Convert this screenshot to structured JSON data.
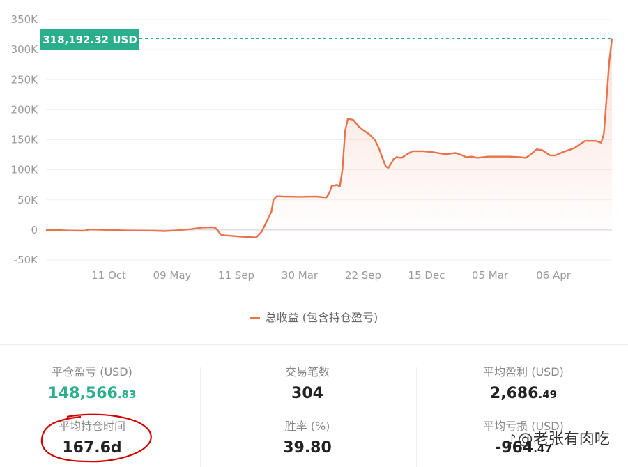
{
  "chart_data": {
    "type": "area",
    "y_ticks": [
      "350K",
      "300K",
      "250K",
      "200K",
      "150K",
      "100K",
      "50K",
      "0",
      "-50K"
    ],
    "y_tick_values": [
      350000,
      300000,
      250000,
      200000,
      150000,
      100000,
      50000,
      0,
      -50000
    ],
    "x_ticks": [
      "11 Oct",
      "09 May",
      "11 Sep",
      "30 Mar",
      "22 Sep",
      "15 Dec",
      "05 Mar",
      "06 Apr"
    ],
    "ylim": [
      -50000,
      350000
    ],
    "current_label": "318,192.32 USD",
    "current_value": 318192.32,
    "series": [
      {
        "name": "总收益 (包含持仓盈亏)",
        "color": "#E8734A",
        "points": [
          [
            0,
            0
          ],
          [
            0.02,
            -200
          ],
          [
            0.04,
            -1000
          ],
          [
            0.07,
            -1400
          ],
          [
            0.075,
            -500
          ],
          [
            0.08,
            800
          ],
          [
            0.1,
            300
          ],
          [
            0.15,
            -800
          ],
          [
            0.2,
            -1200
          ],
          [
            0.22,
            -2000
          ],
          [
            0.24,
            -800
          ],
          [
            0.27,
            1500
          ],
          [
            0.29,
            4000
          ],
          [
            0.31,
            4500
          ],
          [
            0.315,
            3000
          ],
          [
            0.325,
            -8000
          ],
          [
            0.33,
            -9000
          ],
          [
            0.34,
            -9500
          ],
          [
            0.36,
            -11000
          ],
          [
            0.38,
            -12000
          ],
          [
            0.39,
            -12500
          ],
          [
            0.4,
            -3000
          ],
          [
            0.41,
            15000
          ],
          [
            0.418,
            30000
          ],
          [
            0.422,
            50000
          ],
          [
            0.428,
            56000
          ],
          [
            0.44,
            55500
          ],
          [
            0.47,
            55000
          ],
          [
            0.5,
            55500
          ],
          [
            0.52,
            54000
          ],
          [
            0.525,
            60000
          ],
          [
            0.53,
            73000
          ],
          [
            0.54,
            75000
          ],
          [
            0.545,
            72000
          ],
          [
            0.55,
            100000
          ],
          [
            0.555,
            165000
          ],
          [
            0.56,
            185000
          ],
          [
            0.57,
            183000
          ],
          [
            0.58,
            172000
          ],
          [
            0.59,
            165000
          ],
          [
            0.6,
            159000
          ],
          [
            0.61,
            150000
          ],
          [
            0.618,
            135000
          ],
          [
            0.625,
            118000
          ],
          [
            0.63,
            106000
          ],
          [
            0.635,
            103000
          ],
          [
            0.64,
            110000
          ],
          [
            0.645,
            118000
          ],
          [
            0.65,
            121000
          ],
          [
            0.66,
            120000
          ],
          [
            0.67,
            126000
          ],
          [
            0.68,
            131000
          ],
          [
            0.7,
            131000
          ],
          [
            0.72,
            129000
          ],
          [
            0.74,
            126000
          ],
          [
            0.76,
            128000
          ],
          [
            0.77,
            125000
          ],
          [
            0.78,
            121000
          ],
          [
            0.79,
            122000
          ],
          [
            0.8,
            120000
          ],
          [
            0.82,
            122000
          ],
          [
            0.86,
            122000
          ],
          [
            0.88,
            121000
          ],
          [
            0.89,
            120000
          ],
          [
            0.9,
            126000
          ],
          [
            0.91,
            134000
          ],
          [
            0.92,
            133000
          ],
          [
            0.935,
            124000
          ],
          [
            0.945,
            124000
          ],
          [
            0.96,
            130000
          ],
          [
            0.98,
            136000
          ],
          [
            0.99,
            142000
          ],
          [
            1.0,
            148000
          ],
          [
            1.02,
            148000
          ],
          [
            1.03,
            145000
          ],
          [
            1.035,
            160000
          ],
          [
            1.04,
            220000
          ],
          [
            1.045,
            280000
          ],
          [
            1.05,
            318000
          ]
        ]
      }
    ]
  },
  "legend": {
    "label": "总收益 (包含持仓盈亏)"
  },
  "stats": {
    "closed_pnl": {
      "label": "平仓盈亏 (USD)",
      "int": "148,566",
      "dec": ".83"
    },
    "hold_time": {
      "label": "平均持仓时间",
      "value": "167.6d"
    },
    "trades": {
      "label": "交易笔数",
      "value": "304"
    },
    "win_rate": {
      "label": "胜率 (%)",
      "value": "39.80"
    },
    "avg_profit": {
      "label": "平均盈利 (USD)",
      "int": "2,686",
      "dec": ".49"
    },
    "avg_loss": {
      "label": "平均亏损 (USD)",
      "int": "-964",
      "dec": ".47"
    }
  },
  "watermark": {
    "text": "@老张有肉吃"
  },
  "colors": {
    "line": "#E8734A",
    "accent_green": "#2BAE8C",
    "annotation": "#d40000"
  }
}
